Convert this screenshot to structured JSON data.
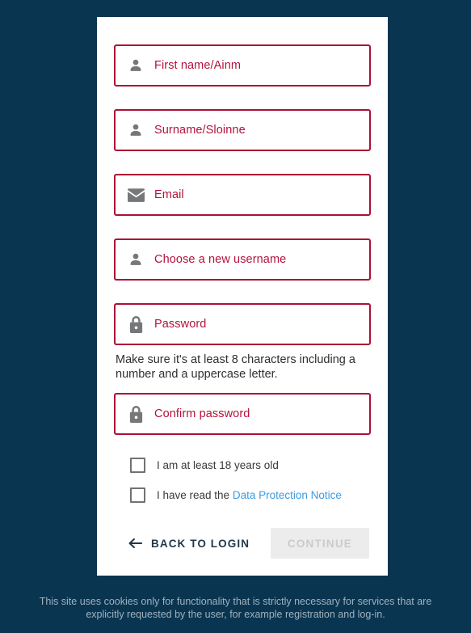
{
  "background_color": "#0a3551",
  "accent_color": "#b3123c",
  "link_color": "#3f9be0",
  "card": {
    "fields": [
      {
        "name": "first-name",
        "icon": "person-icon",
        "placeholder": "First name/Ainm",
        "value": ""
      },
      {
        "name": "surname",
        "icon": "person-icon",
        "placeholder": "Surname/Sloinne",
        "value": ""
      },
      {
        "name": "email",
        "icon": "envelope-icon",
        "placeholder": "Email",
        "value": ""
      },
      {
        "name": "username",
        "icon": "person-icon",
        "placeholder": "Choose a new username",
        "value": ""
      },
      {
        "name": "password",
        "icon": "lock-icon",
        "placeholder": "Password",
        "value": ""
      },
      {
        "name": "confirm-password",
        "icon": "lock-icon",
        "placeholder": "Confirm password",
        "value": ""
      }
    ],
    "password_helper": "Make sure it's at least 8 characters including a number and a uppercase letter.",
    "checkboxes": [
      {
        "name": "age-confirm",
        "label": "I am at least 18 years old",
        "checked": false
      },
      {
        "name": "data-notice",
        "label_prefix": "I have read the ",
        "link_text": "Data Protection Notice",
        "checked": false
      }
    ],
    "actions": {
      "back_label": "BACK TO LOGIN",
      "back_icon": "arrow-left-icon",
      "continue_label": "CONTINUE",
      "continue_disabled": true
    }
  },
  "cookie_banner": {
    "text": "This site uses cookies only for functionality that is strictly necessary for services that are explicitly requested by the user, for example registration and log-in."
  }
}
